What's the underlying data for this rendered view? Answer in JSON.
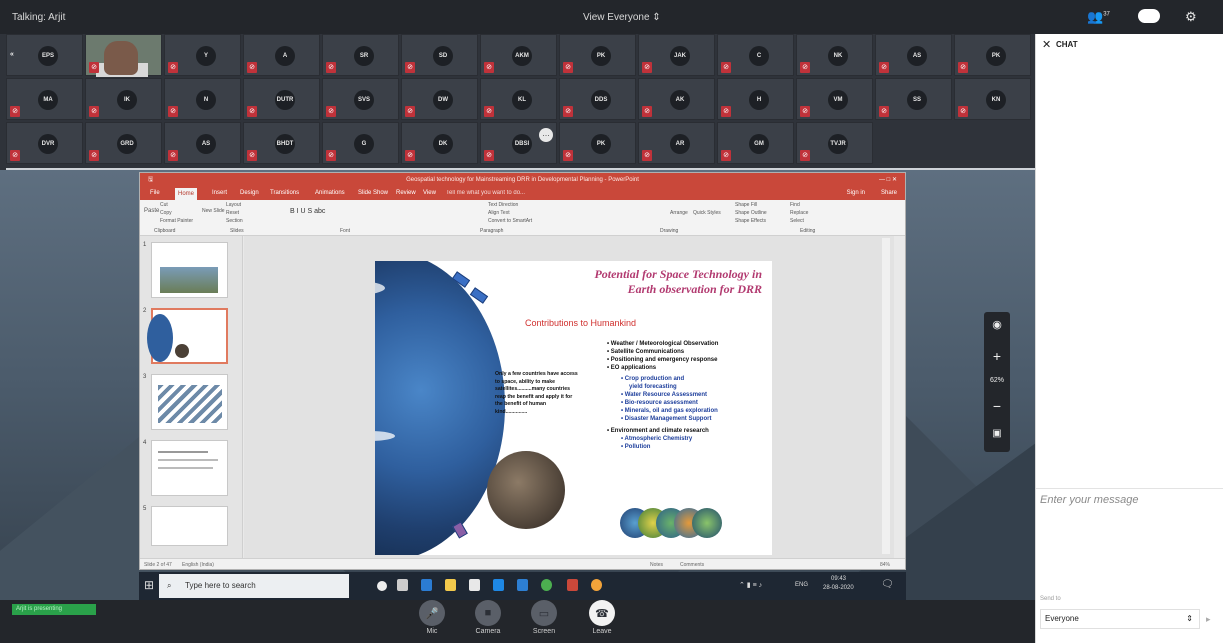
{
  "topbar": {
    "talking": "Talking: Arjit",
    "view": "View Everyone",
    "participant_count": "37"
  },
  "tiles": [
    [
      "EPS",
      "VIDEO",
      "Y",
      "A",
      "SR",
      "SD",
      "AKM",
      "PK",
      "JAK",
      "C",
      "NK",
      "AS",
      "PK"
    ],
    [
      "MA",
      "IK",
      "N",
      "DUTR",
      "SVS",
      "DW",
      "KL",
      "DDS",
      "AK",
      "H",
      "VM",
      "SS",
      "KN"
    ],
    [
      "DVR",
      "GRD",
      "AS",
      "BHDT",
      "G",
      "DK",
      "DBSI",
      "PK",
      "AR",
      "GM",
      "TVJR"
    ]
  ],
  "ppt": {
    "title": "Geospatial technology for Mainstreaming DRR in Developmental Planning - PowerPoint",
    "tabs": [
      "File",
      "Home",
      "Insert",
      "Design",
      "Transitions",
      "Animations",
      "Slide Show",
      "Review",
      "View",
      "Tell me what you want to do..."
    ],
    "signin": "Sign in",
    "share": "Share",
    "ribbon_groups": [
      "Clipboard",
      "Slides",
      "Font",
      "Paragraph",
      "Drawing",
      "Editing"
    ],
    "ribbon_labels": {
      "paste": "Paste",
      "cut": "Cut",
      "copy": "Copy",
      "format_painter": "Format Painter",
      "new_slide": "New Slide",
      "layout": "Layout",
      "reset": "Reset",
      "section": "Section",
      "text_direction": "Text Direction",
      "align_text": "Align Text",
      "convert_smartart": "Convert to SmartArt",
      "arrange": "Arrange",
      "quick_styles": "Quick Styles",
      "shape_fill": "Shape Fill",
      "shape_outline": "Shape Outline",
      "shape_effects": "Shape Effects",
      "find": "Find",
      "replace": "Replace",
      "select": "Select"
    },
    "thumb_numbers": [
      "1",
      "2",
      "3",
      "4",
      "5"
    ],
    "status_left": "Slide 2 of 47",
    "status_lang": "English (India)",
    "status_notes": "Notes",
    "status_comments": "Comments",
    "status_zoom": "84%"
  },
  "slide": {
    "title_line1": "Potential for Space Technology in",
    "title_line2": "Earth observation for DRR",
    "subtitle": "Contributions to Humankind",
    "para": [
      "Only a few countries have access",
      "to space, ability to make",
      "satellites..........many countries",
      "reap the benefit and apply it for",
      "the benefit of human",
      "kind..............."
    ],
    "bullets": [
      "Weather / Meteorological Observation",
      "Satellite Communications",
      "Positioning and emergency response",
      "EO applications"
    ],
    "sub_bullets": [
      "Crop production and",
      "yield forecasting",
      "Water Resource Assessment",
      "Bio-resource assessment",
      "Minerals, oil and gas exploration",
      "Disaster Management Support"
    ],
    "bullet2": "Environment and climate research",
    "sub_bullets2": [
      "Atmospheric Chemistry",
      "Pollution"
    ]
  },
  "taskbar": {
    "search_placeholder": "Type here to search",
    "lang": "ENG",
    "time": "09:43",
    "date": "28-08-2020"
  },
  "zoom": {
    "level": "62%"
  },
  "bottom": {
    "presenting": "Arjit is presenting",
    "mic": "Mic",
    "camera": "Camera",
    "screen": "Screen",
    "leave": "Leave"
  },
  "chat": {
    "title": "CHAT",
    "placeholder": "Enter your message",
    "send_to_label": "Send to",
    "send_to_value": "Everyone"
  }
}
